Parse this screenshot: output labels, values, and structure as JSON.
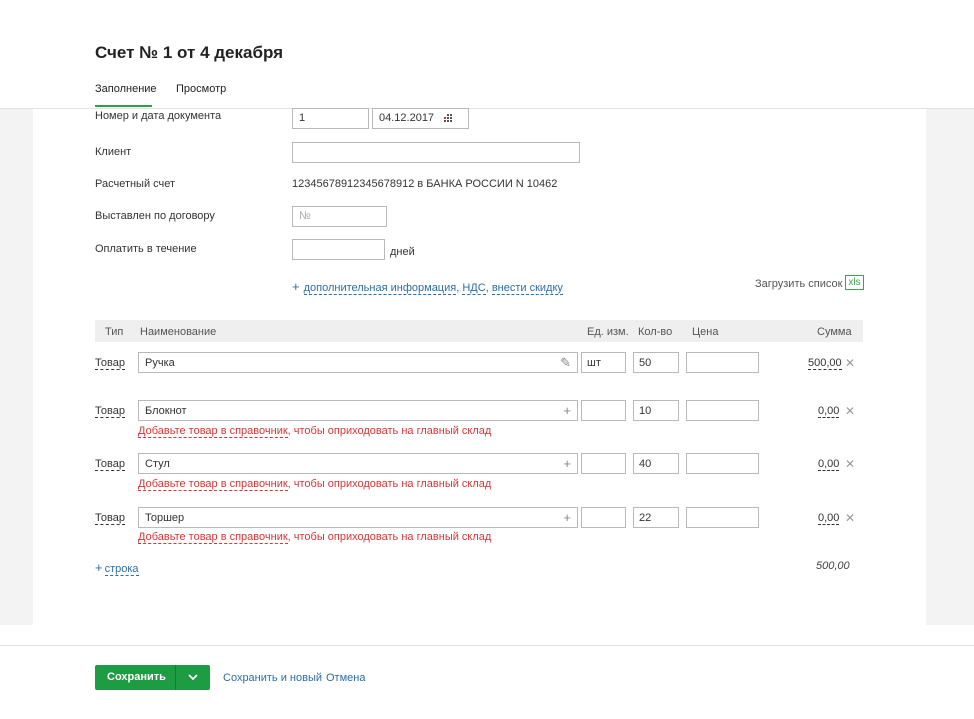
{
  "header": {
    "title": "Счет № 1 от 4 декабря",
    "tabs": [
      {
        "label": "Заполнение",
        "active": true
      },
      {
        "label": "Просмотр",
        "active": false
      }
    ]
  },
  "form": {
    "doc_number_label": "Номер и дата документа",
    "doc_number_value": "1",
    "doc_date_value": "04.12.2017",
    "client_label": "Клиент",
    "client_value": "",
    "account_label": "Расчетный счет",
    "account_value": "12345678912345678912 в БАНКА РОССИИ N 10462",
    "contract_label": "Выставлен по договору",
    "contract_placeholder": "№",
    "pay_within_label": "Оплатить в течение",
    "pay_within_value": "",
    "days_unit": "дней",
    "extra_plus": "+",
    "extra_link_1": "дополнительная информация",
    "extra_sep_1": ", ",
    "extra_link_2": "НДС",
    "extra_sep_2": ", ",
    "extra_link_3": "внести скидку",
    "upload_label": "Загрузить список",
    "upload_badge": "xls"
  },
  "table": {
    "headers": {
      "type": "Тип",
      "name": "Наименование",
      "unit": "Ед. изм.",
      "qty": "Кол-во",
      "price": "Цена",
      "sum": "Сумма"
    },
    "rows": [
      {
        "type": "Товар",
        "name": "Ручка",
        "icon": "pencil-icon",
        "unit": "шт",
        "qty": "50",
        "price": "",
        "sum": "500,00",
        "warning": null
      },
      {
        "type": "Товар",
        "name": "Блокнот",
        "icon": "plus-icon",
        "unit": "",
        "qty": "10",
        "price": "",
        "sum": "0,00",
        "warning": {
          "link": "Добавьте товар в справочник",
          "rest": ", чтобы оприходовать на главный склад"
        }
      },
      {
        "type": "Товар",
        "name": "Стул",
        "icon": "plus-icon",
        "unit": "",
        "qty": "40",
        "price": "",
        "sum": "0,00",
        "warning": {
          "link": "Добавьте товар в справочник",
          "rest": ", чтобы оприходовать на главный склад"
        }
      },
      {
        "type": "Товар",
        "name": "Торшер",
        "icon": "plus-icon",
        "unit": "",
        "qty": "22",
        "price": "",
        "sum": "0,00",
        "warning": {
          "link": "Добавьте товар в справочник",
          "rest": ", чтобы оприходовать на главный склад"
        }
      }
    ],
    "add_row_plus": "+",
    "add_row_label": "строка",
    "total": "500,00"
  },
  "footer": {
    "save_label": "Сохранить",
    "save_new_label": "Сохранить и новый",
    "cancel_label": "Отмена"
  },
  "colors": {
    "accent_green": "#1e9c43",
    "link_blue": "#2a6ea8",
    "warning_red": "#dd3333"
  }
}
